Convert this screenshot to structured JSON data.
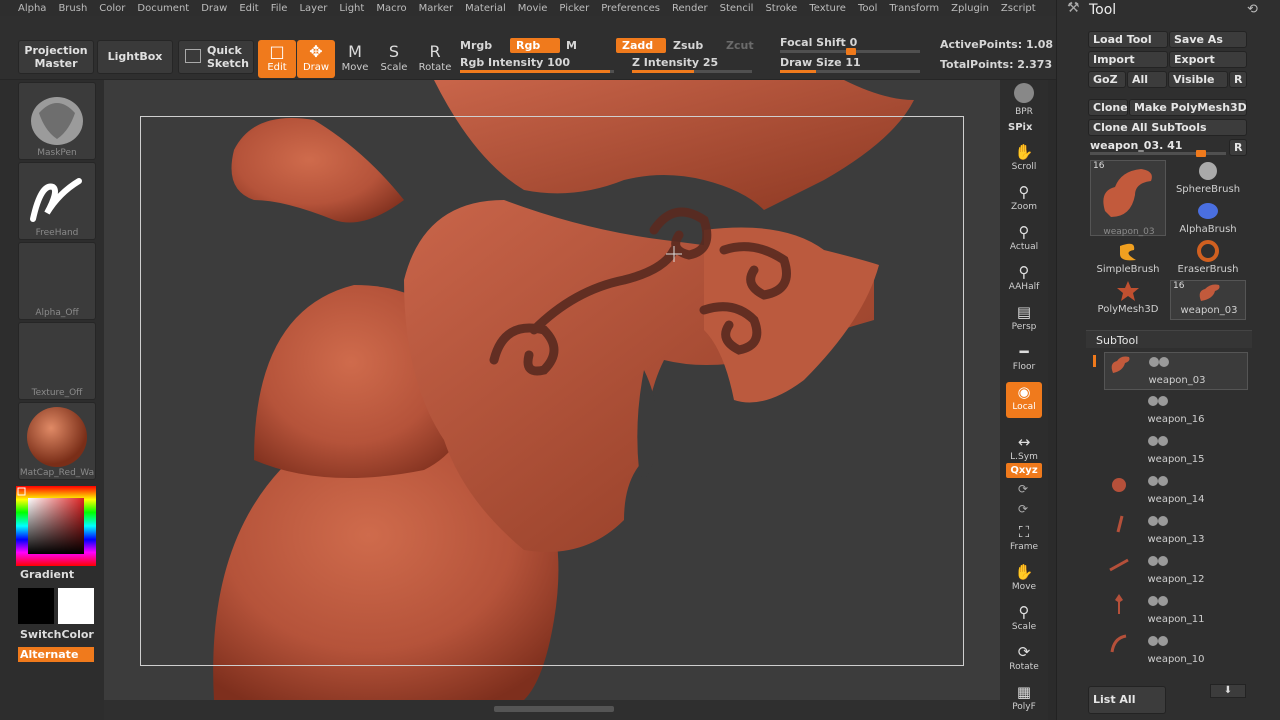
{
  "menu": [
    "Alpha",
    "Brush",
    "Color",
    "Document",
    "Draw",
    "Edit",
    "File",
    "Layer",
    "Light",
    "Macro",
    "Marker",
    "Material",
    "Movie",
    "Picker",
    "Preferences",
    "Render",
    "Stencil",
    "Stroke",
    "Texture",
    "Tool",
    "Transform",
    "Zplugin",
    "Zscript"
  ],
  "toolbar": {
    "projection_master": "Projection Master",
    "lightbox": "LightBox",
    "quick_sketch": "Quick Sketch",
    "edit": "Edit",
    "draw": "Draw",
    "move": "Move",
    "scale": "Scale",
    "rotate": "Rotate",
    "mrgb": "Mrgb",
    "rgb": "Rgb",
    "m": "M",
    "zadd": "Zadd",
    "zsub": "Zsub",
    "zcut": "Zcut",
    "rgb_intensity_label": "Rgb Intensity",
    "rgb_intensity": 100,
    "z_intensity_label": "Z Intensity",
    "z_intensity": 25,
    "focal_shift_label": "Focal Shift",
    "focal_shift": 0,
    "draw_size_label": "Draw Size",
    "draw_size": 11,
    "active_points": "ActivePoints: 1.08",
    "total_points": "TotalPoints: 2.373"
  },
  "left": {
    "brush": "MaskPen",
    "stroke": "FreeHand",
    "alpha": "Alpha_Off",
    "texture": "Texture_Off",
    "material": "MatCap_Red_Wa",
    "gradient": "Gradient",
    "switchcolor": "SwitchColor",
    "alternate": "Alternate"
  },
  "right": {
    "bpr": "BPR",
    "spix": "SPix",
    "scroll": "Scroll",
    "zoom": "Zoom",
    "actual": "Actual",
    "aahalf": "AAHalf",
    "persp": "Persp",
    "floor": "Floor",
    "local": "Local",
    "lsym": "L.Sym",
    "xyz": "Qxyz",
    "frame": "Frame",
    "move": "Move",
    "scale": "Scale",
    "rotate": "Rotate",
    "polyf": "PolyF"
  },
  "tool": {
    "title": "Tool",
    "load_tool": "Load Tool",
    "save_as": "Save As",
    "import": "Import",
    "export": "Export",
    "goz": "GoZ",
    "all": "All",
    "visible": "Visible",
    "r": "R",
    "clone": "Clone",
    "make_polymesh": "Make PolyMesh3D",
    "clone_all": "Clone All SubTools",
    "current_tool": "weapon_03. 41",
    "thumbs": [
      {
        "name": "weapon_03",
        "count": "16"
      },
      {
        "name": "SphereBrush"
      },
      {
        "name": "AlphaBrush"
      },
      {
        "name": "SimpleBrush"
      },
      {
        "name": "EraserBrush"
      },
      {
        "name": "PolyMesh3D"
      },
      {
        "name": "weapon_03",
        "count": "16"
      }
    ],
    "subtool_title": "SubTool",
    "subtools": [
      "weapon_03",
      "weapon_16",
      "weapon_15",
      "weapon_14",
      "weapon_13",
      "weapon_12",
      "weapon_11",
      "weapon_10"
    ],
    "list_all": "List All"
  },
  "colors": {
    "accent": "#f07a1c",
    "clay": "#b9553a"
  }
}
